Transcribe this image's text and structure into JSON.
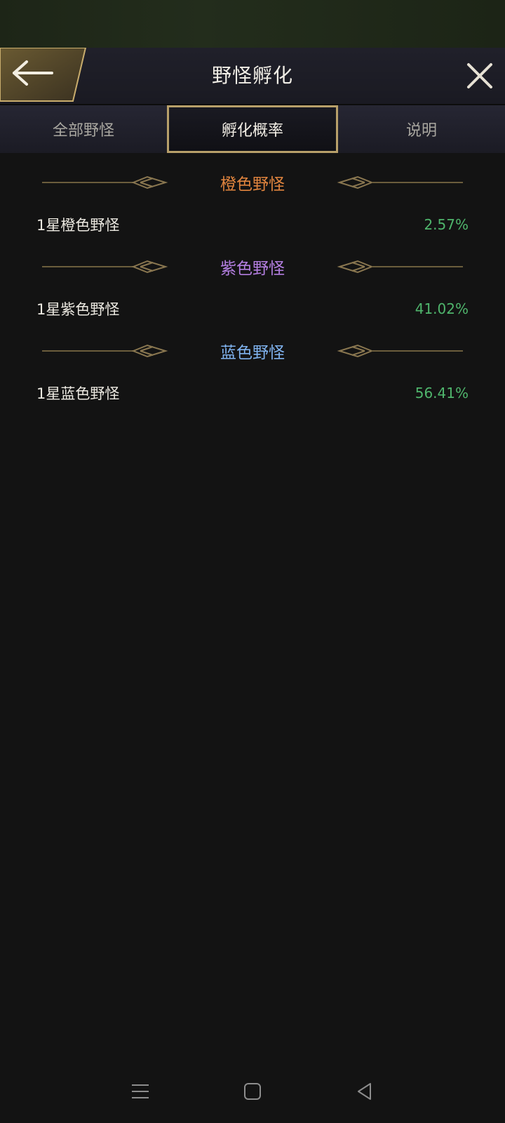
{
  "header": {
    "title": "野怪孵化",
    "back_icon": "back-arrow-icon",
    "close_icon": "close-icon"
  },
  "tabs": [
    {
      "label": "全部野怪",
      "active": false
    },
    {
      "label": "孵化概率",
      "active": true
    },
    {
      "label": "说明",
      "active": false
    }
  ],
  "sections": [
    {
      "title": "橙色野怪",
      "color": "#e0843e",
      "rows": [
        {
          "name": "1星橙色野怪",
          "value": "2.57%"
        }
      ]
    },
    {
      "title": "紫色野怪",
      "color": "#b37ee0",
      "rows": [
        {
          "name": "1星紫色野怪",
          "value": "41.02%"
        }
      ]
    },
    {
      "title": "蓝色野怪",
      "color": "#7fb2ee",
      "rows": [
        {
          "name": "1星蓝色野怪",
          "value": "56.41%"
        }
      ]
    }
  ],
  "colors": {
    "accent": "#b8a06a",
    "value_green": "#4fb56c"
  },
  "navbar": [
    "menu-icon",
    "home-icon",
    "back-triangle-icon"
  ]
}
